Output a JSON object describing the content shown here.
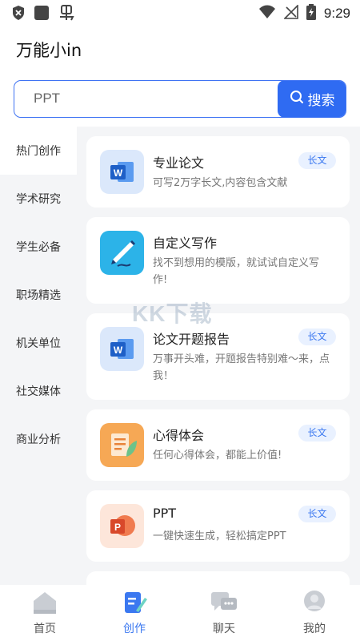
{
  "status_bar": {
    "time": "9:29",
    "left_icons": [
      "shield-icon",
      "app-square-icon",
      "bug-icon"
    ],
    "right_icons": [
      "wifi-icon",
      "no-signal-icon",
      "battery-charging-icon"
    ]
  },
  "app": {
    "title": "万能小in"
  },
  "search": {
    "value": "PPT",
    "button_label": "搜索"
  },
  "categories": [
    {
      "label": "热门创作",
      "active": true
    },
    {
      "label": "学术研究"
    },
    {
      "label": "学生必备"
    },
    {
      "label": "职场精选"
    },
    {
      "label": "机关单位"
    },
    {
      "label": "社交媒体"
    },
    {
      "label": "商业分析"
    }
  ],
  "cards": [
    {
      "title": "专业论文",
      "desc": "可写2万字长文,内容包含文献",
      "badge": "长文",
      "icon": "word-icon"
    },
    {
      "title": "自定义写作",
      "desc": "找不到想用的模版，就试试自定义写作!",
      "badge": "",
      "icon": "pen-writing-icon"
    },
    {
      "title": "论文开题报告",
      "desc": "万事开头难，开题报告特别难～来，点我！",
      "badge": "长文",
      "icon": "word-icon"
    },
    {
      "title": "心得体会",
      "desc": "任何心得体会，都能上价值!",
      "badge": "长文",
      "icon": "notes-leaf-icon"
    },
    {
      "title": "PPT",
      "desc": "一键快速生成，轻松搞定PPT",
      "badge": "长文",
      "icon": "powerpoint-icon"
    }
  ],
  "watermark": "KK下载",
  "bottom_nav": [
    {
      "label": "首页",
      "icon": "home-icon"
    },
    {
      "label": "创作",
      "icon": "create-icon",
      "active": true
    },
    {
      "label": "聊天",
      "icon": "chat-icon"
    },
    {
      "label": "我的",
      "icon": "profile-icon"
    }
  ],
  "colors": {
    "accent": "#2f6bf2",
    "badge_bg": "#e9f1ff",
    "badge_text": "#3b78f0",
    "side_bg": "#f4f5f7"
  }
}
